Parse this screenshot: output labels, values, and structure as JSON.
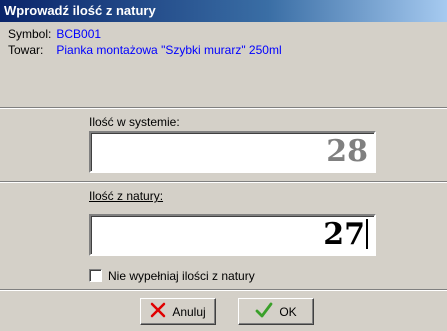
{
  "window": {
    "title": "Wprowadź ilość z natury"
  },
  "product": {
    "symbol_label": "Symbol:",
    "symbol_value": "BCB001",
    "item_label": "Towar:",
    "item_value": "Pianka montażowa \"Szybki murarz\" 250ml"
  },
  "system_qty": {
    "label": "Ilość w systemie:",
    "value": "28"
  },
  "nature_qty": {
    "label": "Ilość z natury:",
    "value": "27"
  },
  "checkbox": {
    "label": "Nie wypełniaj ilości z natury",
    "checked": false
  },
  "buttons": {
    "cancel_label": "Anuluj",
    "ok_label": "OK"
  },
  "colors": {
    "title_bar": "#0a246a",
    "value_text": "#0000ff",
    "cancel_icon": "#e00000",
    "ok_icon": "#3aa02a"
  }
}
